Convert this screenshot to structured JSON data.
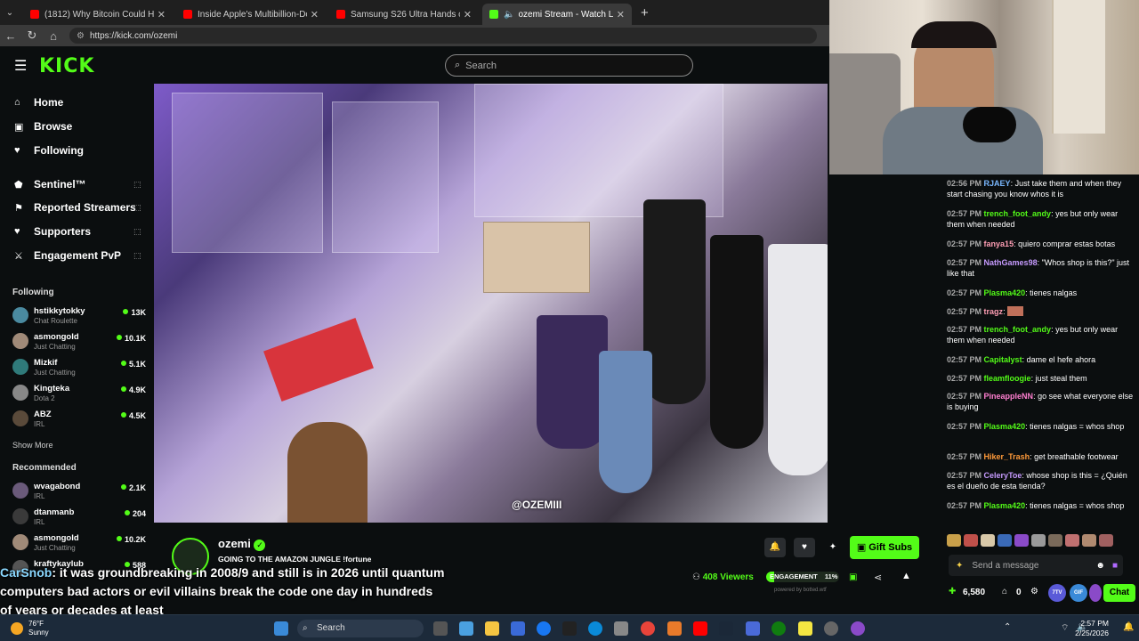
{
  "browser": {
    "tabs": [
      {
        "title": "(1812) Why Bitcoin Could Hit $0 -",
        "active": false,
        "color": "#ff0000"
      },
      {
        "title": "Inside Apple's Multibillion-Dollar F",
        "active": false,
        "color": "#ff0000"
      },
      {
        "title": "Samsung S26 Ultra Hands on - Th",
        "active": false,
        "color": "#ff0000"
      },
      {
        "title": "ozemi Stream - Watch Live o",
        "active": true,
        "color": "#53fc18"
      }
    ],
    "new_tab": "+",
    "url": "https://kick.com/ozemi"
  },
  "site": {
    "logo": "KICK",
    "search_placeholder": "Search",
    "accent": "#53fc18"
  },
  "sidebar": {
    "nav": [
      {
        "label": "Home",
        "icon": "home-icon"
      },
      {
        "label": "Browse",
        "icon": "browse-icon"
      },
      {
        "label": "Following",
        "icon": "heart-icon"
      }
    ],
    "tools": [
      {
        "label": "Sentinel™",
        "icon": "shield-icon"
      },
      {
        "label": "Reported Streamers",
        "icon": "flag-icon"
      },
      {
        "label": "Supporters",
        "icon": "heart-icon"
      },
      {
        "label": "Engagement PvP",
        "icon": "swords-icon"
      }
    ],
    "following_title": "Following",
    "following": [
      {
        "name": "hstikkytokky",
        "category": "Chat Roulette",
        "viewers": "13K"
      },
      {
        "name": "asmongold",
        "category": "Just Chatting",
        "viewers": "10.1K"
      },
      {
        "name": "Mizkif",
        "category": "Just Chatting",
        "viewers": "5.1K"
      },
      {
        "name": "Kingteka",
        "category": "Dota 2",
        "viewers": "4.9K"
      },
      {
        "name": "ABZ",
        "category": "IRL",
        "viewers": "4.5K"
      }
    ],
    "show_more": "Show More",
    "recommended_title": "Recommended",
    "recommended": [
      {
        "name": "wvagabond",
        "category": "IRL",
        "viewers": "2.1K"
      },
      {
        "name": "dtanmanb",
        "category": "IRL",
        "viewers": "204"
      },
      {
        "name": "asmongold",
        "category": "Just Chatting",
        "viewers": "10.2K"
      },
      {
        "name": "kraftykaylub",
        "category": "",
        "viewers": "588"
      }
    ]
  },
  "video": {
    "watermark": "@OZEMIII"
  },
  "stream": {
    "name": "ozemi",
    "title": "GOING TO THE AMAZON JUNGLE !fortune",
    "viewers": "408 Viewers",
    "engagement_label": "ENGAGEMENT",
    "engagement_value": "11%",
    "engagement_fraction": 0.11,
    "powered_by": "powered by botted.wtf",
    "gift_label": "Gift Subs"
  },
  "chat": {
    "messages": [
      {
        "time": "02:56 PM",
        "user": "RJAEY",
        "color": "#7ab8ff",
        "text": "Just take them and when they start chasing you know whos it is"
      },
      {
        "time": "02:57 PM",
        "user": "trench_foot_andy",
        "color": "#53fc18",
        "text": "yes but only wear them when needed"
      },
      {
        "time": "02:57 PM",
        "user": "fanya15",
        "color": "#ff9fb5",
        "text": "quiero comprar estas botas"
      },
      {
        "time": "02:57 PM",
        "user": "NathGames98",
        "color": "#c79bff",
        "text": "\"Whos shop is this?\" just like that"
      },
      {
        "time": "02:57 PM",
        "user": "Plasma420",
        "color": "#53fc18",
        "text": "tienes nalgas"
      },
      {
        "time": "02:57 PM",
        "user": "tragz",
        "color": "#ff9fb5",
        "text": ""
      },
      {
        "time": "02:57 PM",
        "user": "trench_foot_andy",
        "color": "#53fc18",
        "text": "yes but only wear them when needed"
      },
      {
        "time": "02:57 PM",
        "user": "Capitalyst",
        "color": "#53fc18",
        "text": "dame el hefe ahora"
      },
      {
        "time": "02:57 PM",
        "user": "fleamfloogie",
        "color": "#53fc18",
        "text": "just steal them"
      },
      {
        "time": "02:57 PM",
        "user": "PineappleNN",
        "color": "#ff7fd0",
        "text": "go see what everyone else is buying"
      },
      {
        "time": "02:57 PM",
        "user": "Plasma420",
        "color": "#53fc18",
        "text": "tienes nalgas = whos shop"
      },
      {
        "time": "02:57 PM",
        "user": "Hiker_Trash",
        "color": "#ff9a3a",
        "text": "get breathable footwear"
      },
      {
        "time": "02:57 PM",
        "user": "CeleryToe",
        "color": "#c79bff",
        "text": "whose shop is this = ¿Quién es el dueño de esta tienda?"
      },
      {
        "time": "02:57 PM",
        "user": "Plasma420",
        "color": "#53fc18",
        "text": "tienes nalgas = whos shop"
      }
    ],
    "input_placeholder": "Send a message",
    "points": "6,580",
    "count": "0",
    "chat_button": "Chat"
  },
  "overlay": {
    "user": "CarSnob",
    "text": ": it was groundbreaking in 2008/9 and still is in 2026 until quantum computers bad actors or evil villains break the code one day in hundreds of years or decades at least"
  },
  "taskbar": {
    "temp": "76°F",
    "weather": "Sunny",
    "search": "Search",
    "time": "2:57 PM",
    "date": "2/25/2026"
  }
}
